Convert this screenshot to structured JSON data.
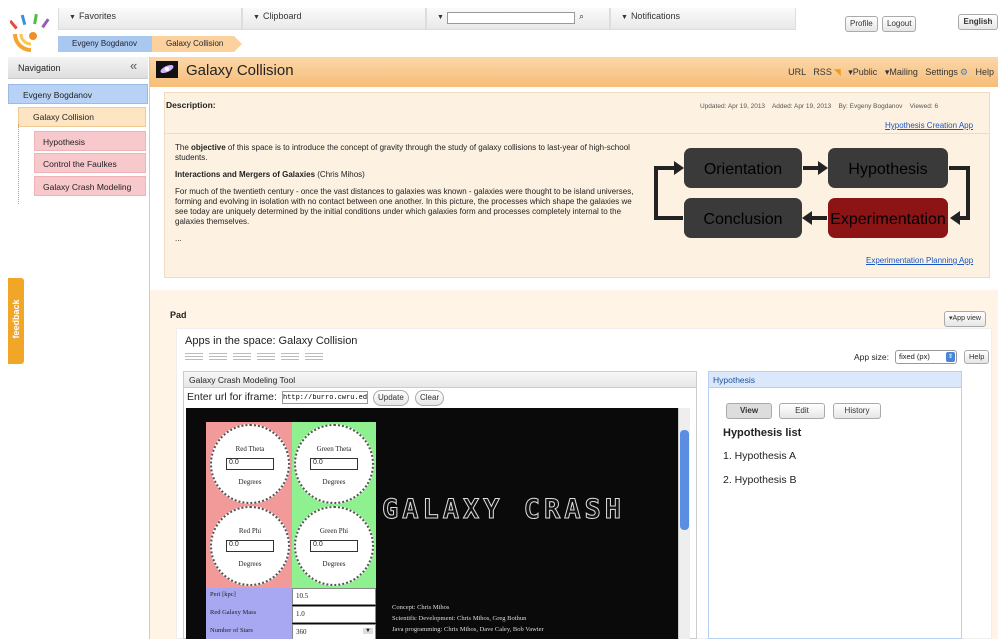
{
  "topbar": {
    "favorites": "Favorites",
    "clipboard": "Clipboard",
    "notifications": "Notifications",
    "search_value": "",
    "profile": "Profile",
    "logout": "Logout",
    "language": "English"
  },
  "breadcrumb": [
    "Evgeny Bogdanov",
    "Galaxy Collision"
  ],
  "nav": {
    "title": "Navigation",
    "collapse": "«",
    "user": "Evgeny Bogdanov",
    "space": "Galaxy Collision",
    "items": [
      "Hypothesis",
      "Control the Faulkes",
      "Galaxy Crash Modeling"
    ],
    "feedback": "feedback"
  },
  "page": {
    "title": "Galaxy Collision",
    "menu": [
      "URL",
      "RSS",
      "▾Public",
      "▾Mailing",
      "Settings",
      "Help"
    ]
  },
  "description": {
    "label": "Description:",
    "updated": "Updated: Apr 19, 2013",
    "added": "Added: Apr 19, 2013",
    "by": "By: Evgeny Bogdanov",
    "viewed": "Viewed: 6",
    "link_top": "Hypothesis Creation App",
    "link_bottom": "Experimentation Planning App",
    "p1_pre": "The ",
    "p1_bold": "objective",
    "p1_post": " of this space is to introduce the concept of gravity through the study of galaxy collisions to last-year of high-school students.",
    "h_bold": "Interactions and Mergers of Galaxies",
    "h_post": " (Chris Mihos)",
    "p2": "For much of the twentieth century - once the vast distances to galaxies was known - galaxies were thought to be island universes, forming and evolving in isolation with no contact between one another. In this picture, the processes which shape the galaxies we see today are uniquely determined by the initial conditions under which galaxies form and processes completely internal to the galaxies themselves.",
    "ellipsis": "...",
    "cycle": [
      "Orientation",
      "Hypothesis",
      "Conclusion",
      "Experimentation"
    ]
  },
  "pad": {
    "label": "Pad",
    "app_view": "▾App view",
    "apps_title": "Apps in the space: Galaxy Collision",
    "app_size_label": "App size:",
    "app_size_value": "fixed (px)",
    "help": "Help"
  },
  "tool": {
    "title": "Galaxy Crash Modeling Tool",
    "url_label": "Enter url for iframe:",
    "url_value": "http://burro.cwru.edu",
    "update": "Update",
    "clear": "Clear",
    "dials": [
      {
        "label": "Red Theta",
        "value": "0.0",
        "unit": "Degrees"
      },
      {
        "label": "Green Theta",
        "value": "0.0",
        "unit": "Degrees"
      },
      {
        "label": "Red Phi",
        "value": "0.0",
        "unit": "Degrees"
      },
      {
        "label": "Green Phi",
        "value": "0.0",
        "unit": "Degrees"
      }
    ],
    "params": [
      {
        "label": "Peri [kpc]",
        "value": "10.5"
      },
      {
        "label": "Red Galaxy Mass",
        "value": "1.0"
      },
      {
        "label": "Number of Stars",
        "value": "360"
      }
    ],
    "banner": "GALAXY CRASH",
    "credits": [
      "Concept: Chris Mihos",
      "Scientific Development: Chris Mihos, Greg Bothun",
      "Java programming: Chris Mihos, Dave Caley, Bob Vawter"
    ]
  },
  "hypothesis": {
    "title": "Hypothesis",
    "tabs": [
      "View",
      "Edit",
      "History"
    ],
    "heading": "Hypothesis list",
    "items": [
      "1. Hypothesis A",
      "2. Hypothesis B"
    ]
  }
}
